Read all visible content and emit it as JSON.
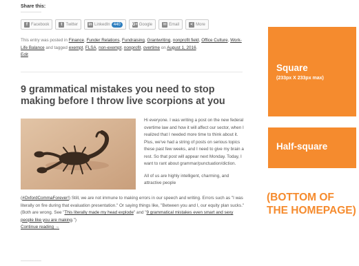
{
  "share": {
    "label": "Share this:",
    "buttons": [
      {
        "label": "Facebook",
        "icon": "f"
      },
      {
        "label": "Twitter",
        "icon": "t"
      },
      {
        "label": "LinkedIn",
        "icon": "in",
        "count": "440"
      },
      {
        "label": "Google",
        "icon": "G+"
      },
      {
        "label": "Email",
        "icon": "✉"
      },
      {
        "label": "More",
        "icon": "<"
      }
    ]
  },
  "meta": {
    "prefix": "This entry was posted in",
    "categories": [
      "Finance",
      "Funder Relations",
      "Fundraising",
      "Grantwriting",
      "nonprofit field",
      "Office Culture",
      "Work-Life Balance"
    ],
    "tagged": "and tagged",
    "tags": [
      "exempt",
      "FLSA",
      "non-exempt",
      "nonprofit",
      "overtime"
    ],
    "on": "on",
    "date": "August 1, 2016",
    "edit": "Edit"
  },
  "post": {
    "title": "9 grammatical mistakes you need to stop making before I throw live scorpions at you",
    "p1": "Hi everyone. I was writing a post on the new federal overtime law and how it will affect our sector, when I realized that I needed more time to think about it. Plus, we've had a string of posts on serious topics these past few weeks, and I need to give my brain a rest. So that post will appear next Monday. Today, I want to rant about grammar/punctuation/diction.",
    "p2_start": "All of us are highly intelligent, charming, and attractive people",
    "p2_hashtag": "#OxfordCommaForever!",
    "p2_mid": "Still, we are not immune to making errors in our speech and writing. Errors such as \"I was literally on fire during that evaluation presentation.\" Or saying things like, \"Between you and I, our equity plan sucks.\" (Both are wrong. See \"",
    "link1": "This literally made my head explode",
    "p2_and": "\" and \"",
    "link2": "9 grammatical mistakes even smart and sexy people like you are making",
    "p2_end": ".\")",
    "continue": "Continue reading →"
  },
  "ads": {
    "square_title": "Square",
    "square_sub": "(233px X 233px max)",
    "half_title": "Half-square",
    "bottom_note": "(BOTTOM OF THE HOMEPAGE)"
  },
  "colors": {
    "accent": "#f58b2e",
    "badge": "#2f7fbf"
  }
}
